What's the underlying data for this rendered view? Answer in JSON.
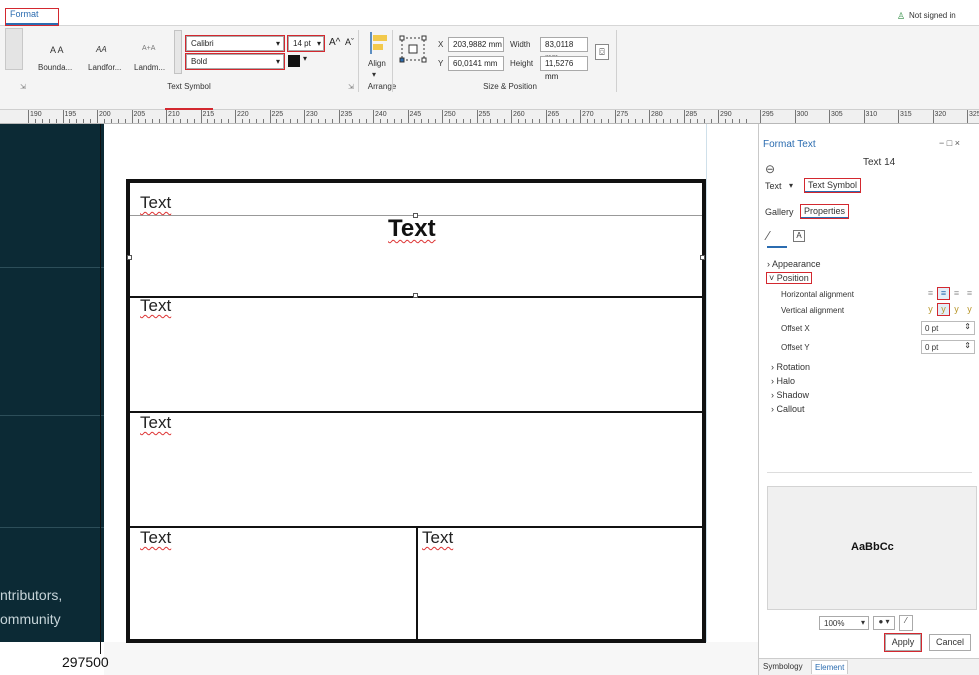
{
  "ribbon": {
    "active_tab": "Format",
    "signin": "Not signed in",
    "styles": [
      "A A",
      "AA",
      "A+A"
    ],
    "style_names": [
      "Bounda...",
      "Landfor...",
      "Landm..."
    ],
    "font_name": "Calibri",
    "font_size": "14 pt",
    "font_style": "Bold",
    "grow": "A^",
    "shrink": "Aˇ",
    "group_text_symbol": "Text Symbol",
    "align_label": "Align",
    "group_arrange": "Arrange",
    "x_label": "X",
    "x_value": "203,9882 mm",
    "y_label": "Y",
    "y_value": "60,0141 mm",
    "width_label": "Width",
    "width_value": "83,0118 mm",
    "height_label": "Height",
    "height_value": "11,5276 mm",
    "group_size": "Size & Position"
  },
  "ruler": {
    "labels": [
      "190",
      "195",
      "200",
      "205",
      "210",
      "215",
      "220",
      "225",
      "230",
      "235",
      "240",
      "245",
      "250",
      "255",
      "260",
      "265",
      "270",
      "275",
      "280",
      "285",
      "290"
    ],
    "labels2": [
      "295",
      "300",
      "305",
      "310",
      "315",
      "320",
      "325"
    ]
  },
  "map": {
    "text1": "ntributors,",
    "text2": "ommunity",
    "coord": "297500"
  },
  "layout": {
    "texts": [
      "Text",
      "Text",
      "Text",
      "Text",
      "Text",
      "Text"
    ]
  },
  "panel": {
    "title": "Format Text",
    "controls": "− □ ×",
    "element_name": "Text 14",
    "tab_text": "Text",
    "tab_symbol": "Text Symbol",
    "gallery": "Gallery",
    "properties": "Properties",
    "appearance": "Appearance",
    "position": "Position",
    "h_align": "Horizontal alignment",
    "v_align": "Vertical alignment",
    "offset_x": "Offset X",
    "offset_x_val": "0 pt",
    "offset_y": "Offset Y",
    "offset_y_val": "0 pt",
    "rotation": "Rotation",
    "halo": "Halo",
    "shadow": "Shadow",
    "callout": "Callout",
    "preview": "AaBbCc",
    "zoom": "100%",
    "apply": "Apply",
    "cancel": "Cancel",
    "bottom_tabs": [
      "Symbology",
      "Element"
    ]
  }
}
